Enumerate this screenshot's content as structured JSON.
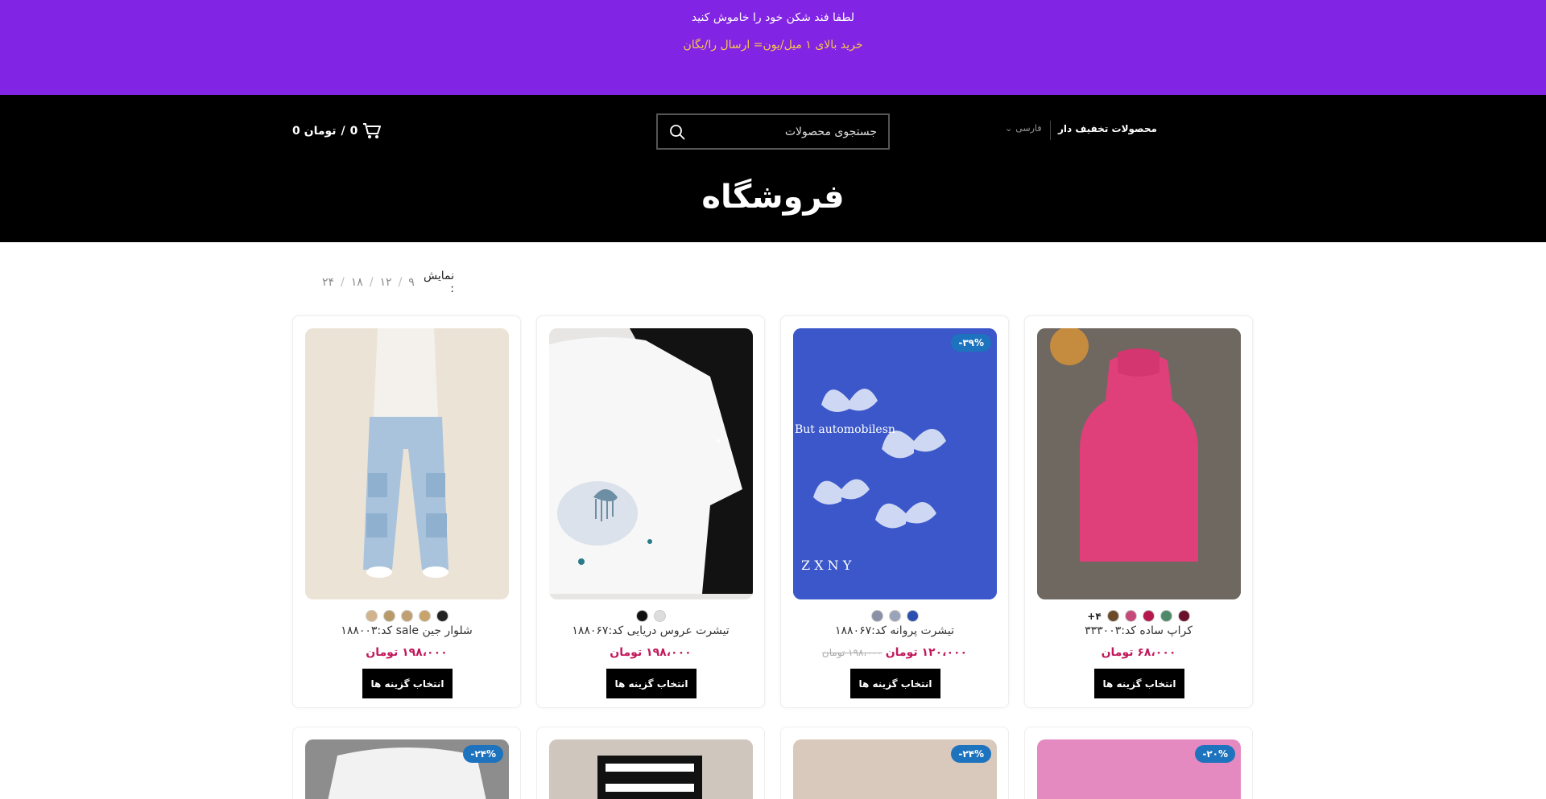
{
  "topbar": {
    "line1": "لطفا فند شکن خود را خاموش کنید",
    "line2": "خرید بالای ۱ میل/یون= ارسال را/یگان"
  },
  "header": {
    "cart_count": "0",
    "cart_sep": "/",
    "cart_price": "0 تومان",
    "search_placeholder": "جستجوی محصولات",
    "lang_label": "فارسی",
    "nav_link": "محصولات تخفیف دار",
    "page_title": "فروشگاه"
  },
  "show": {
    "label": "نمایش :",
    "options": [
      "۹",
      "۱۲",
      "۱۸",
      "۲۴"
    ]
  },
  "products": [
    {
      "title": "کراپ ساده کد:۳۳۳۰۰۳",
      "price": "۶۸،۰۰۰ تومان",
      "old_price": "",
      "badge": "",
      "button": "انتخاب گزینه ها",
      "swatches": [
        "#6b0f2a",
        "#4e8a6a",
        "#b5174d",
        "#c44a7a",
        "#6b4a2a"
      ],
      "more": "+۴"
    },
    {
      "title": "تیشرت پروانه کد:۱۸۸۰۶۷",
      "price": "۱۲۰،۰۰۰ تومان",
      "old_price": "۱۹۸،۰۰۰ تومان",
      "badge": "-۳۹%",
      "button": "انتخاب گزینه ها",
      "swatches": [
        "#2a4fb0",
        "#9aa3b8",
        "#8a90a6"
      ],
      "more": ""
    },
    {
      "title": "تیشرت عروس دریایی کد:۱۸۸۰۶۷",
      "price": "۱۹۸،۰۰۰ تومان",
      "old_price": "",
      "badge": "",
      "button": "انتخاب گزینه ها",
      "swatches": [
        "#dddddd",
        "#111111"
      ],
      "more": ""
    },
    {
      "title": "شلوار جین sale کد:۱۸۸۰۰۳",
      "price": "۱۹۸،۰۰۰ تومان",
      "old_price": "",
      "badge": "",
      "button": "انتخاب گزینه ها",
      "swatches": [
        "#222222",
        "#c9a46a",
        "#c0a070",
        "#b89a6a",
        "#d2b48c"
      ],
      "more": ""
    }
  ],
  "products_row2": [
    {
      "badge": "-۲۰%"
    },
    {
      "badge": "-۲۴%"
    },
    {
      "badge": ""
    },
    {
      "badge": "-۲۴%"
    }
  ],
  "colors": {
    "topbar_bg": "#8224e3",
    "header_bg": "#000000",
    "price": "#c2185b",
    "badge": "#1e73be"
  }
}
